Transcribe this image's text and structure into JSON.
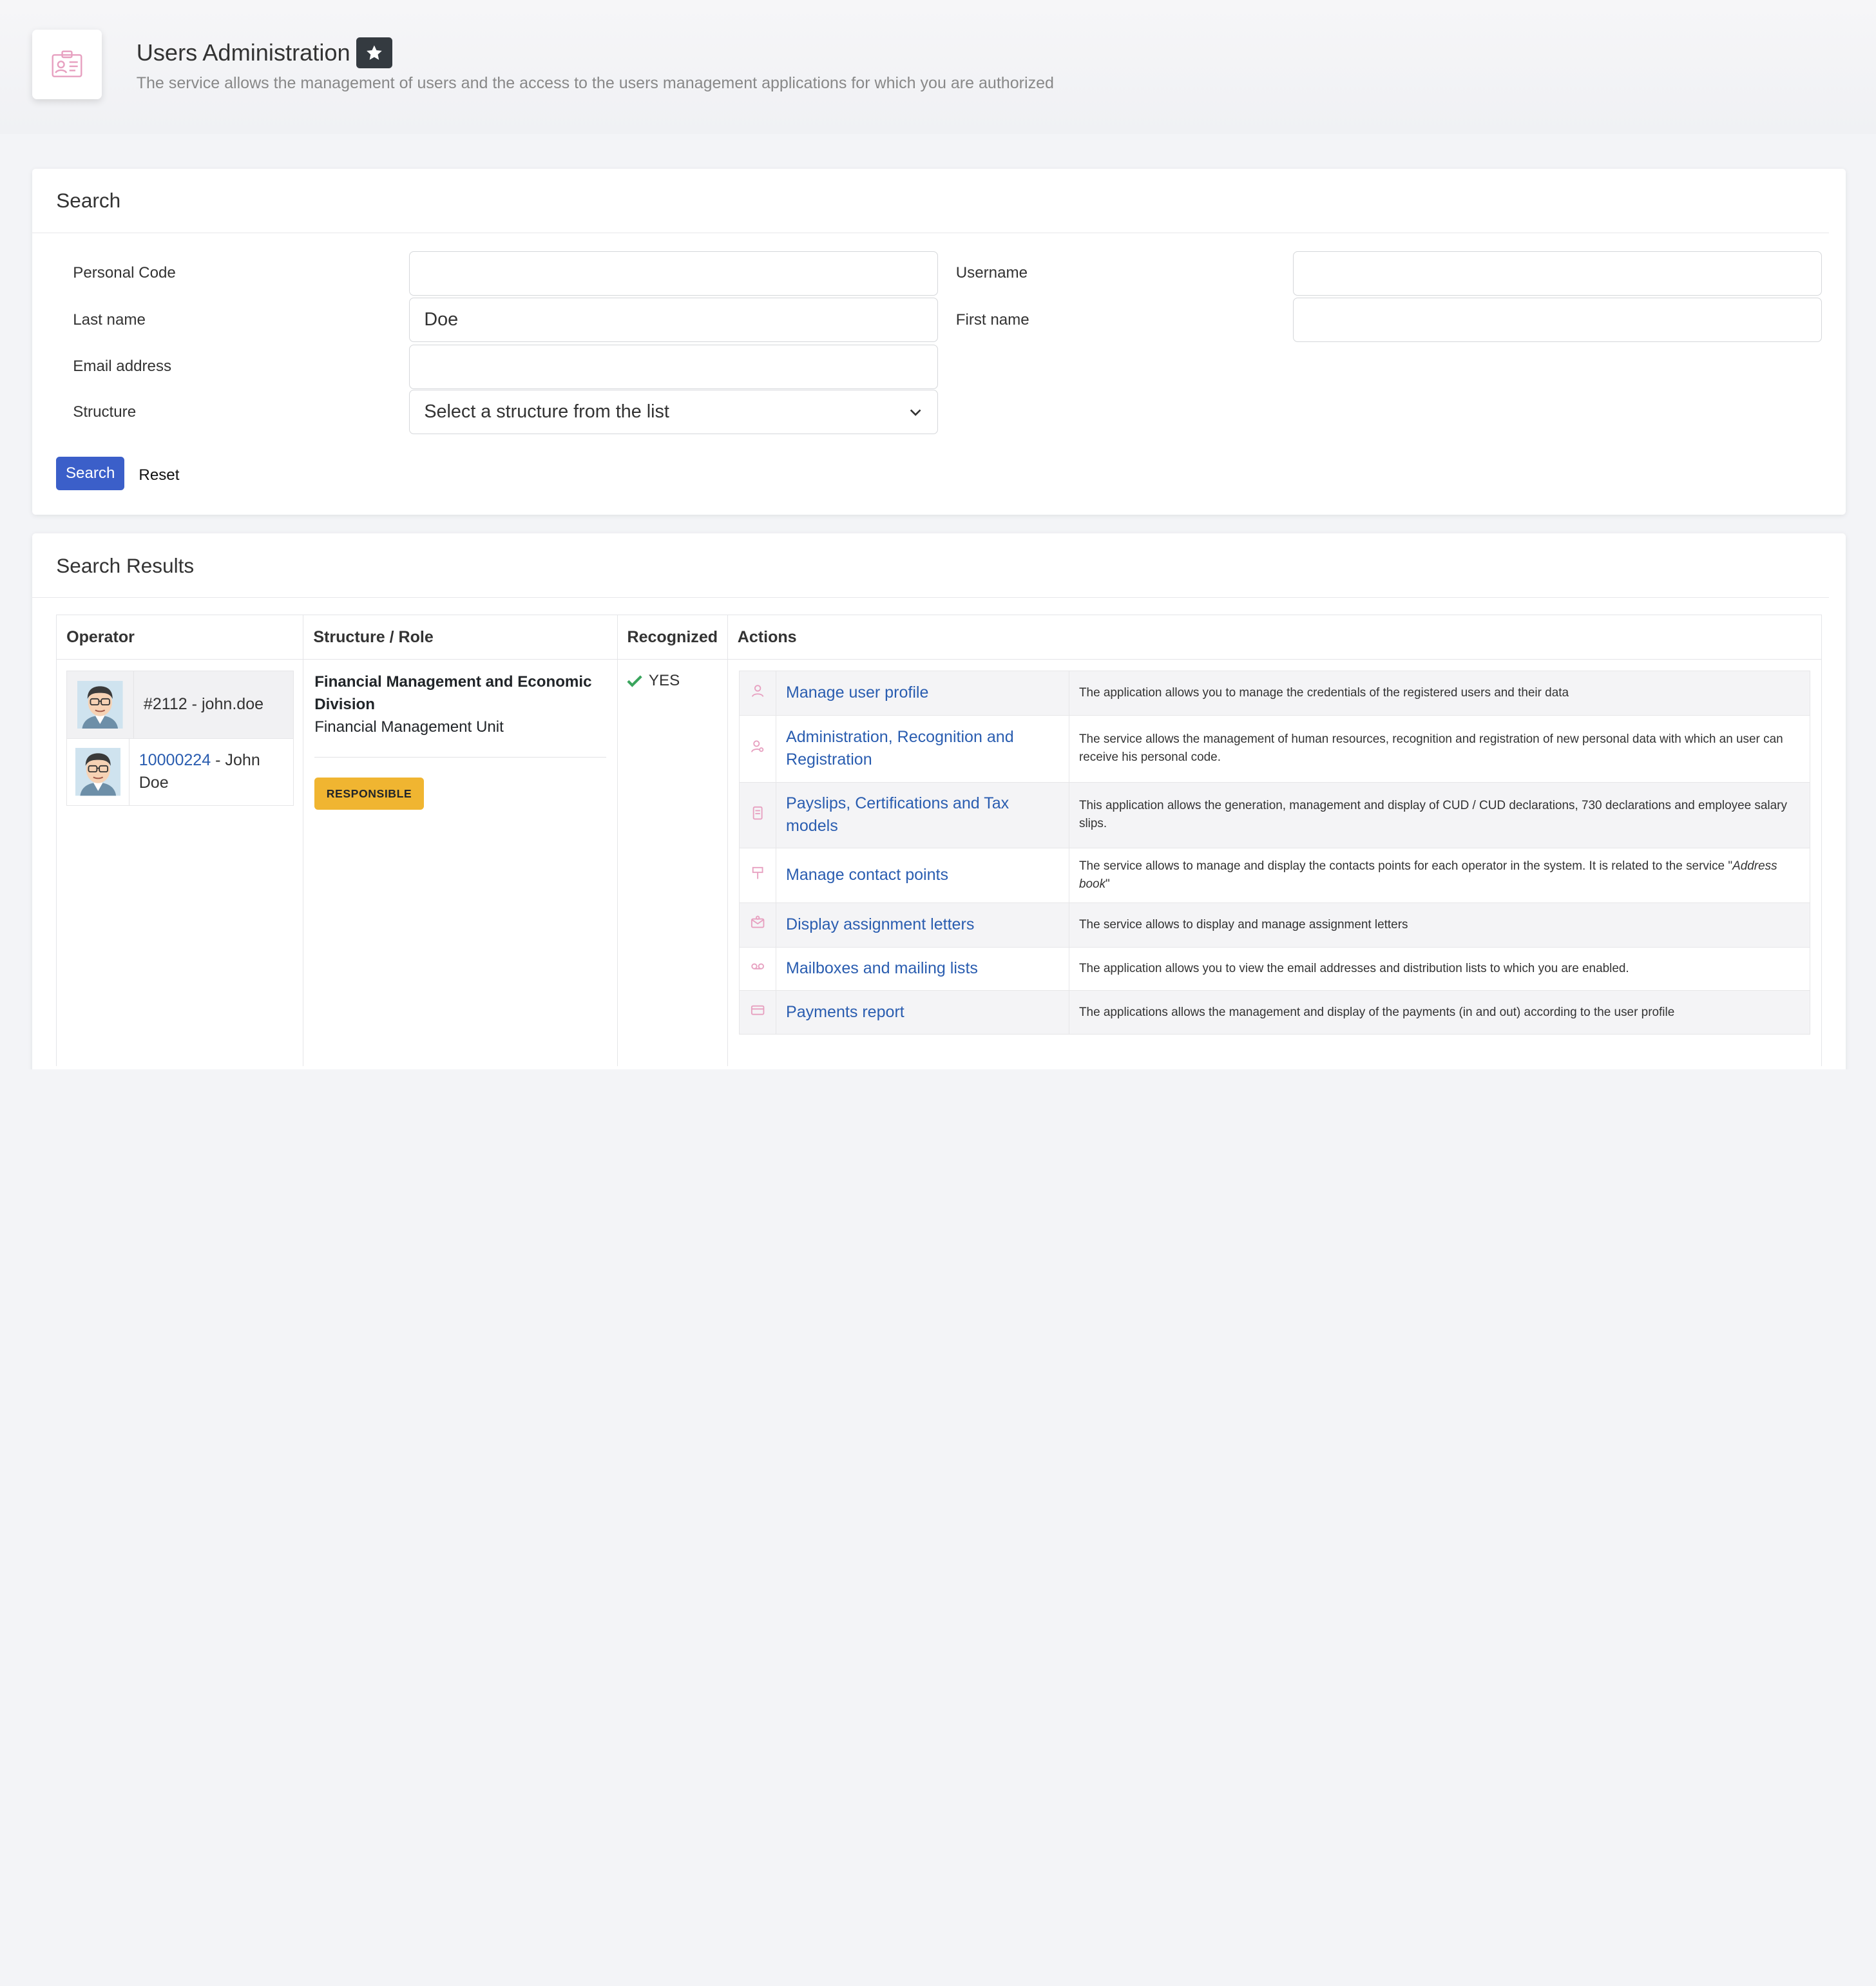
{
  "header": {
    "title": "Users Administration",
    "subtitle": "The service allows the management of users and the access to the users management applications for which you are authorized",
    "icon": "id-card-icon",
    "favorite_icon": "star-icon"
  },
  "search": {
    "title": "Search",
    "fields": {
      "personal_code": {
        "label": "Personal Code",
        "value": ""
      },
      "username": {
        "label": "Username",
        "value": ""
      },
      "last_name": {
        "label": "Last name",
        "value": "Doe"
      },
      "first_name": {
        "label": "First name",
        "value": ""
      },
      "email": {
        "label": "Email address",
        "value": ""
      },
      "structure": {
        "label": "Structure",
        "value": "Select a structure from the list"
      }
    },
    "search_label": "Search",
    "reset_label": "Reset",
    "colors": {
      "primary": "#3b5fc9"
    }
  },
  "results": {
    "title": "Search Results",
    "columns": [
      "Operator",
      "Structure / Role",
      "Recognized",
      "Actions"
    ],
    "operator": {
      "rows": [
        {
          "prefix": "#2112 - john.doe",
          "link": "",
          "suffix": ""
        },
        {
          "prefix": "",
          "link": "10000224",
          "suffix": " - John Doe"
        }
      ]
    },
    "structure": {
      "division": "Financial Management and Economic Division",
      "unit": "Financial Management Unit",
      "role_badge": "RESPONSIBLE",
      "badge_color": "#f0b531"
    },
    "recognized": {
      "value": "YES",
      "icon": "check-icon",
      "color": "#3aa55d"
    },
    "actions": [
      {
        "icon": "user-icon",
        "name": "Manage user profile",
        "description": "The application allows you to manage the credentials of the registered users and their data"
      },
      {
        "icon": "user-search-icon",
        "name": "Administration, Recognition and Registration",
        "description": "The service allows the management of human resources, recognition and registration of new personal data with which an user can receive his personal code."
      },
      {
        "icon": "document-icon",
        "name": "Payslips, Certifications and Tax models",
        "description": "This application allows the generation, management and display of CUD / CUD declarations, 730 declarations and employee salary slips."
      },
      {
        "icon": "signpost-icon",
        "name": "Manage contact points",
        "description_pre": "The service allows to manage and display the contacts points for each operator in the system. It is related to the service \"",
        "description_em": "Address book",
        "description_post": "\""
      },
      {
        "icon": "letter-icon",
        "name": "Display assignment letters",
        "description": "The service allows to display and manage assignment letters"
      },
      {
        "icon": "voicemail-icon",
        "name": "Mailboxes and mailing lists",
        "description": "The application allows you to view the email addresses and distribution lists to which you are enabled."
      },
      {
        "icon": "payment-card-icon",
        "name": "Payments report",
        "description": "The applications allows the management and display of the payments (in and out) according to the user profile"
      }
    ]
  }
}
